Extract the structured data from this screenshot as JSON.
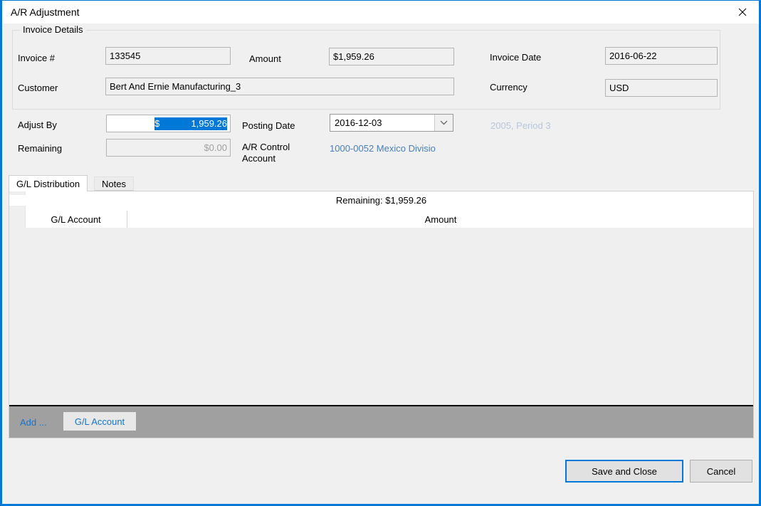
{
  "window": {
    "title": "A/R Adjustment",
    "close_icon": "close-icon",
    "accent_color": "#0078d7"
  },
  "invoice_details": {
    "group_title": "Invoice Details",
    "fields": {
      "invoice_number_label": "Invoice #",
      "invoice_number_value": "133545",
      "amount_label": "Amount",
      "amount_value": "$1,959.26",
      "invoice_date_label": "Invoice Date",
      "invoice_date_value": "2016-06-22",
      "customer_label": "Customer",
      "customer_value": "Bert And Ernie Manufacturing_3",
      "currency_label": "Currency",
      "currency_value": "USD"
    }
  },
  "adjustment": {
    "adjust_by_label": "Adjust By",
    "adjust_by_currency_symbol": "$",
    "adjust_by_value": "1,959.26",
    "adjust_by_selected": true,
    "remaining_label": "Remaining",
    "remaining_value": "$0.00",
    "posting_date_label": "Posting Date",
    "posting_date_value": "2016-12-03",
    "posting_date_arrow_icon": "chevron-down-icon",
    "period_text": "2005, Period 3",
    "ar_control_account_label_line1": "A/R Control",
    "ar_control_account_label_line2": "Account",
    "ar_control_account_value": "1000-0052 Mexico Divisio"
  },
  "tabs": [
    {
      "label": "G/L Distribution",
      "active": true
    },
    {
      "label": "Notes",
      "active": false
    }
  ],
  "grid": {
    "remaining_summary": "Remaining: $1,959.26",
    "columns": [
      "G/L Account",
      "Amount"
    ],
    "rows": [],
    "toolbar": {
      "add_label": "Add ...",
      "gl_account_button": "G/L Account"
    }
  },
  "footer": {
    "save_label": "Save and Close",
    "cancel_label": "Cancel"
  }
}
